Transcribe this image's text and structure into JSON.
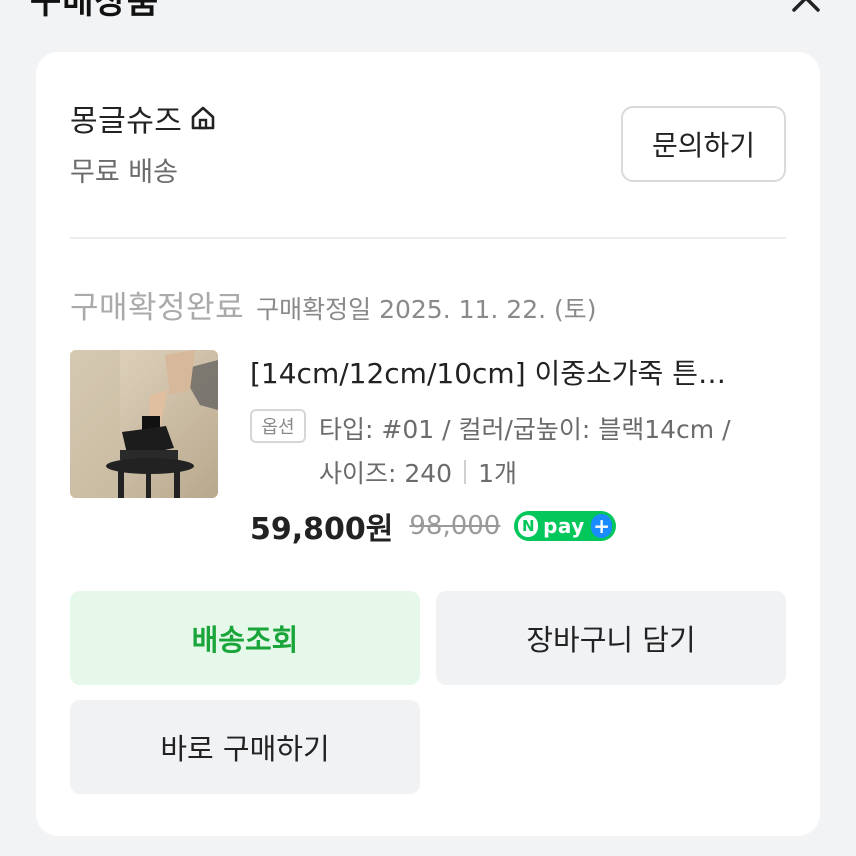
{
  "header": {
    "title": "구매상품",
    "close_icon": "close-icon"
  },
  "store": {
    "name": "몽글슈즈",
    "home_icon": "home-icon",
    "shipping": "무료 배송",
    "inquiry_label": "문의하기"
  },
  "order": {
    "status": "구매확정완료",
    "confirm_date": "구매확정일 2025. 11. 22. (토)"
  },
  "product": {
    "title": "[14cm/12cm/10cm] 이중소가죽 튼…",
    "option_badge": "옵션",
    "option_line1": "타입: #01 / 컬러/굽높이: 블랙14cm /",
    "option_size": "사이즈: 240",
    "quantity": "1개",
    "price": "59,800원",
    "original_price": "98,000",
    "npay_n": "N",
    "npay_label": "pay",
    "npay_plus": "+"
  },
  "actions": {
    "track_label": "배송조회",
    "cart_label": "장바구니 담기",
    "buy_label": "바로 구매하기"
  },
  "colors": {
    "accent_green": "#1aa53b",
    "track_bg": "#e6f8ea",
    "npay_green": "#03c75a"
  }
}
